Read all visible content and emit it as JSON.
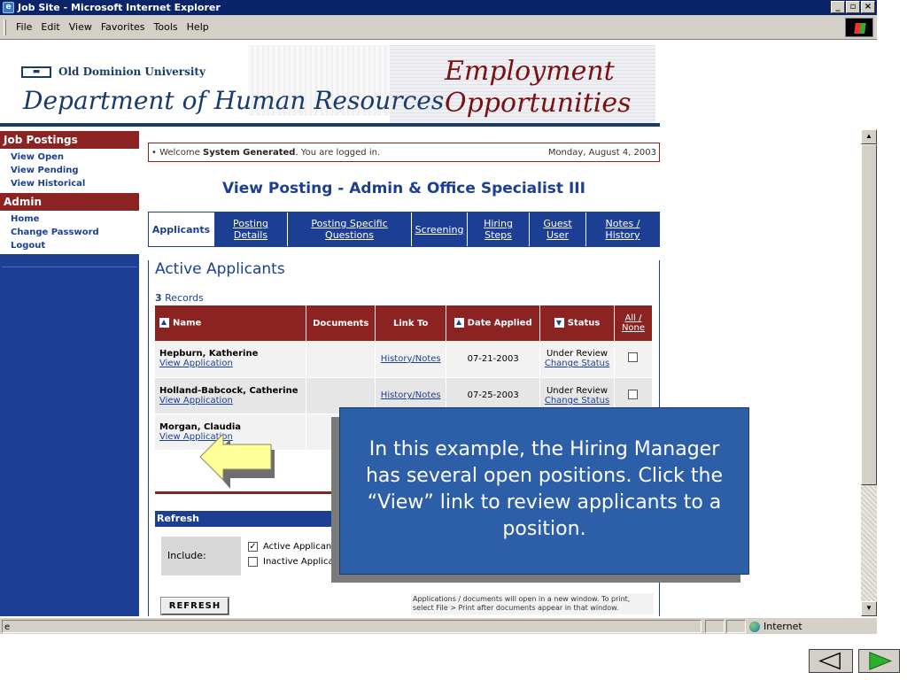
{
  "window": {
    "title": "Job Site - Microsoft Internet Explorer"
  },
  "menu": {
    "items": [
      "File",
      "Edit",
      "View",
      "Favorites",
      "Tools",
      "Help"
    ]
  },
  "banner": {
    "university": "Old Dominion University",
    "department": "Department of Human Resources",
    "heading_line1": "Employment",
    "heading_line2": "Opportunities"
  },
  "sidebar": {
    "job_postings_header": "Job Postings",
    "job_links": [
      "View Open",
      "View Pending",
      "View Historical"
    ],
    "admin_header": "Admin",
    "admin_links": [
      "Home",
      "Change Password",
      "Logout"
    ]
  },
  "welcome": {
    "prefix": "• Welcome ",
    "user": "System Generated",
    "suffix": ". You are logged in.",
    "date": "Monday, August 4, 2003"
  },
  "page_title": "View Posting - Admin & Office Specialist III",
  "tabs": [
    {
      "label": "Applicants"
    },
    {
      "label1": "Posting",
      "label2": "Details"
    },
    {
      "label1": "Posting Specific",
      "label2": "Questions"
    },
    {
      "label": "Screening"
    },
    {
      "label1": "Hiring",
      "label2": "Steps"
    },
    {
      "label1": "Guest",
      "label2": "User"
    },
    {
      "label1": "Notes /",
      "label2": "History"
    }
  ],
  "applicants": {
    "title": "Active Applicants",
    "record_count": "3",
    "record_label": " Records",
    "columns": {
      "name": "Name",
      "documents": "Documents",
      "link_to": "Link To",
      "date_applied": "Date Applied",
      "status": "Status",
      "all": "All /",
      "none": "None"
    },
    "rows": [
      {
        "name": "Hepburn, Katherine",
        "view": "View Application",
        "link": "History/Notes",
        "date": "07-21-2003",
        "status": "Under Review",
        "change": "Change Status"
      },
      {
        "name": "Holland-Babcock, Catherine",
        "view": "View Application",
        "link": "History/Notes",
        "date": "07-25-2003",
        "status": "Under Review",
        "change": "Change Status"
      },
      {
        "name": "Morgan, Claudia",
        "view": "View Application",
        "link": "",
        "date": "",
        "status": "",
        "change": ""
      }
    ]
  },
  "refresh": {
    "bar_label": "Refresh",
    "include_label": "Include:",
    "opt_active": "Active Applicants",
    "opt_inactive": "Inactive Applicants",
    "button": "REFRESH",
    "note": "Applications / documents will open in a new window. To print, select File > Print after documents appear in that window."
  },
  "callout": {
    "text": "In this example, the Hiring Manager has several open positions.  Click the “View” link to review applicants to a position."
  },
  "status_bar": {
    "zone": "Internet"
  },
  "colors": {
    "navy": "#1c3f94",
    "maroon": "#8b2323",
    "callout": "#2d5fa8"
  }
}
